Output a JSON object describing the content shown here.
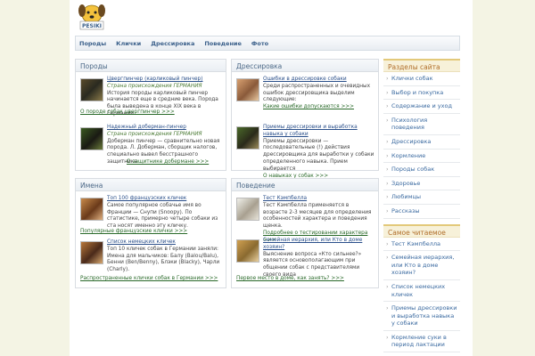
{
  "logo": {
    "text": "PESIKI"
  },
  "nav": [
    "Породы",
    "Клички",
    "Дрессировка",
    "Поведение",
    "Фото"
  ],
  "sections": {
    "breeds": {
      "title": "Породы",
      "items": [
        {
          "title": "Цвергпинчер (карликовый пинчер)",
          "country": "Страна происхождения ГЕРМАНИЯ",
          "text": "История породы карликовый пинчер начинается еще в средние века. Порода была выведена в конце XIX века в Германии",
          "more": "О породе собак цвергпинчер >>>"
        },
        {
          "title": "Надежный доберман-пинчер",
          "country": "Страна происхождения ГЕРМАНИЯ",
          "text": "Доберман пинчер — сравнительно новая порода. Л. Доберман, сборщик налогов, специально вывел бесстрашного защитника",
          "more": "О защитнике добермане >>>"
        }
      ]
    },
    "training": {
      "title": "Дрессировка",
      "items": [
        {
          "title": "Ошибки в дрессировке собаки",
          "text": "Среди распространенных и очевидных ошибок дрессировщика выделим следующие:",
          "more": "Какие ошибки допускаются >>>"
        },
        {
          "title": "Приемы дрессировки и выработка навыка у собаки",
          "text": "Приемы дрессировки — последовательные (!) действия дрессировщика для выработки у собаки определенного навыка. Прием выбирается",
          "more": "О навыках у собак >>>"
        }
      ]
    },
    "names": {
      "title": "Имена",
      "items": [
        {
          "title": "Топ 100 французских кличек",
          "text": "Самое популярное собачье имя во Франции — Снупи (Snoopy). По статистике, примерно четыре собаки из ста носят именно эту кличку.",
          "more": "Популярные французские клички >>>"
        },
        {
          "title": "Список немецких кличек",
          "text": "Топ 10 кличек собак в Германии заняли: Имена для мальчиков: Балу (Balou/Balu), Бенни (Ben/Benny), Блэки (Blacky), Чарли (Charly).",
          "more": "Распространенные клички собак в Германии >>>"
        }
      ]
    },
    "behavior": {
      "title": "Поведение",
      "items": [
        {
          "title": "Тест Кэмпбелла",
          "text": "Тест Кэмпбелла применяется в возрасте 2-3 месяцев для определения особенностей характера и поведения щенка.",
          "more": "Подробнее о тестировании характера >>>"
        },
        {
          "title": "Семейная иерархия, или Кто в доме хозяин?",
          "text": "Выяснение вопроса «Кто сильнее?» является основополагающим при общении собак с представителями своего вида",
          "more": "Первое место в доме, как занять? >>>"
        }
      ]
    }
  },
  "sidebar": {
    "sections_title": "Разделы сайта",
    "sections_items": [
      "Клички собак",
      "Выбор и покупка",
      "Содержание и уход",
      "Психология поведения",
      "Дрессировка",
      "Кормление",
      "Породы собак",
      "Здоровье",
      "Любимцы",
      "Рассказы"
    ],
    "popular_title": "Самое читаемое",
    "popular_items": [
      "Тест Кэмпбелла",
      "Семейная иерархия, или Кто в доме хозяин?",
      "Список немецких кличек",
      "Приемы дрессировки и выработка навыка у собаки",
      "Кормление суки в период лактации"
    ]
  }
}
